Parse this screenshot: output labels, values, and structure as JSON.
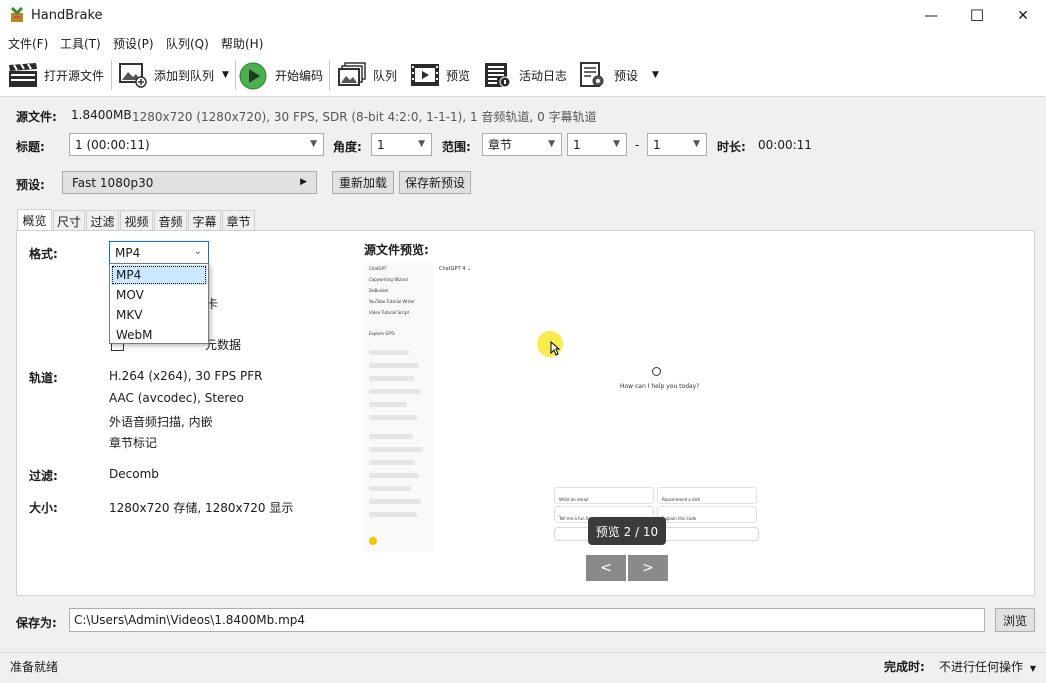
{
  "window": {
    "title": "HandBrake",
    "minimize": "—",
    "maximize": "☐",
    "close": "✕"
  },
  "menu": [
    "文件(F)",
    "工具(T)",
    "预设(P)",
    "队列(Q)",
    "帮助(H)"
  ],
  "toolbar": {
    "open_source": "打开源文件",
    "add_to_queue": "添加到队列",
    "start_encode": "开始编码",
    "queue": "队列",
    "preview": "预览",
    "activity_log": "活动日志",
    "presets": "预设"
  },
  "source": {
    "label": "源文件:",
    "name": "1.8400MB",
    "info": "1280x720 (1280x720), 30 FPS, SDR (8-bit 4:2:0, 1-1-1), 1 音频轨道, 0 字幕轨道"
  },
  "title_row": {
    "title_label": "标题:",
    "title_value": "1  (00:00:11)",
    "angle_label": "角度:",
    "angle_value": "1",
    "range_label": "范围:",
    "range_mode": "章节",
    "range_start": "1",
    "range_dash": "-",
    "range_end": "1",
    "duration_label": "时长:",
    "duration_value": "00:00:11"
  },
  "preset_row": {
    "label": "预设:",
    "value": "Fast 1080p30",
    "reload": "重新加载",
    "save_new": "保存新预设"
  },
  "tabs": [
    "概览",
    "尺寸",
    "过滤",
    "视频",
    "音频",
    "字幕",
    "章节"
  ],
  "summary": {
    "format_label": "格式:",
    "format_value": "MP4",
    "format_options": [
      "MP4",
      "MOV",
      "MKV",
      "WebM"
    ],
    "partial_text_1": "卡",
    "partial_text_2": "元数据",
    "tracks_label": "轨道:",
    "tracks": [
      "H.264 (x264), 30 FPS PFR",
      "AAC (avcodec), Stereo",
      "外语音频扫描, 内嵌",
      "章节标记"
    ],
    "filters_label": "过滤:",
    "filters_value": "Decomb",
    "size_label": "大小:",
    "size_value": "1280x720 存储, 1280x720 显示"
  },
  "preview": {
    "label": "源文件预览:",
    "counter": "预览 2 / 10",
    "prev_btn": "<",
    "next_btn": ">",
    "sidebar_items": [
      "ChatGPT",
      "Copywriting Wizard",
      "DeBunker",
      "YouTube Tutorial Writer",
      "Video Tutorial Script",
      "Explore GPTs"
    ],
    "header": "ChatGPT 4 ⌄",
    "prompt": "How can I help you today?",
    "cards": [
      "Write an email",
      "Recommend a dish",
      "Tell me a fun fact",
      "Explain this code"
    ]
  },
  "save": {
    "label": "保存为:",
    "path": "C:\\Users\\Admin\\Videos\\1.8400Mb.mp4",
    "browse": "浏览"
  },
  "status": {
    "ready": "准备就绪",
    "when_done_label": "完成时:",
    "when_done_value": "不进行任何操作"
  },
  "colors": {
    "accent": "#cce8ff",
    "play_green": "#4caf50",
    "cursor_yellow": "#f5e830"
  }
}
